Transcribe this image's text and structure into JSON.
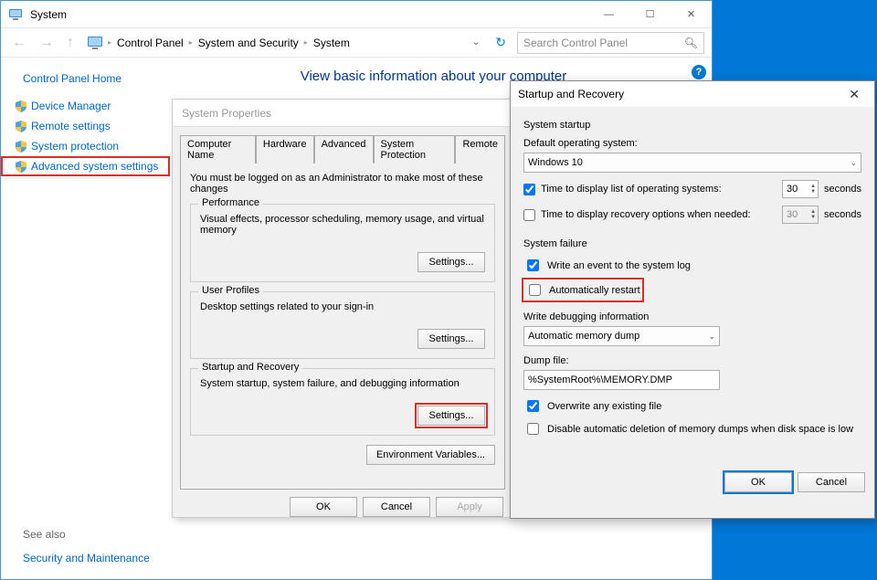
{
  "window": {
    "title": "System"
  },
  "breadcrumb": {
    "items": [
      "Control Panel",
      "System and Security",
      "System"
    ]
  },
  "search": {
    "placeholder": "Search Control Panel"
  },
  "sidebar": {
    "home": "Control Panel Home",
    "items": [
      {
        "label": "Device Manager"
      },
      {
        "label": "Remote settings"
      },
      {
        "label": "System protection"
      },
      {
        "label": "Advanced system settings"
      }
    ],
    "see_also_heading": "See also",
    "see_also_link": "Security and Maintenance"
  },
  "content": {
    "title": "View basic information about your computer"
  },
  "sysprops": {
    "title": "System Properties",
    "tabs": [
      "Computer Name",
      "Hardware",
      "Advanced",
      "System Protection",
      "Remote"
    ],
    "active_tab": "Advanced",
    "note": "You must be logged on as an Administrator to make most of these changes",
    "groups": {
      "performance": {
        "title": "Performance",
        "desc": "Visual effects, processor scheduling, memory usage, and virtual memory",
        "button": "Settings..."
      },
      "userprofiles": {
        "title": "User Profiles",
        "desc": "Desktop settings related to your sign-in",
        "button": "Settings..."
      },
      "startup": {
        "title": "Startup and Recovery",
        "desc": "System startup, system failure, and debugging information",
        "button": "Settings..."
      }
    },
    "env_button": "Environment Variables...",
    "buttons": {
      "ok": "OK",
      "cancel": "Cancel",
      "apply": "Apply"
    }
  },
  "startup_recovery": {
    "title": "Startup and Recovery",
    "system_startup": {
      "heading": "System startup",
      "default_os_label": "Default operating system:",
      "default_os_value": "Windows 10",
      "time_list_label": "Time to display list of operating systems:",
      "time_list_value": "30",
      "time_list_checked": true,
      "time_recovery_label": "Time to display recovery options when needed:",
      "time_recovery_value": "30",
      "time_recovery_checked": false,
      "seconds": "seconds"
    },
    "system_failure": {
      "heading": "System failure",
      "write_event": {
        "label": "Write an event to the system log",
        "checked": true
      },
      "auto_restart": {
        "label": "Automatically restart",
        "checked": false
      },
      "write_debug_label": "Write debugging information",
      "write_debug_value": "Automatic memory dump",
      "dump_file_label": "Dump file:",
      "dump_file_value": "%SystemRoot%\\MEMORY.DMP",
      "overwrite": {
        "label": "Overwrite any existing file",
        "checked": true
      },
      "disable_delete": {
        "label": "Disable automatic deletion of memory dumps when disk space is low",
        "checked": false
      }
    },
    "buttons": {
      "ok": "OK",
      "cancel": "Cancel"
    }
  }
}
